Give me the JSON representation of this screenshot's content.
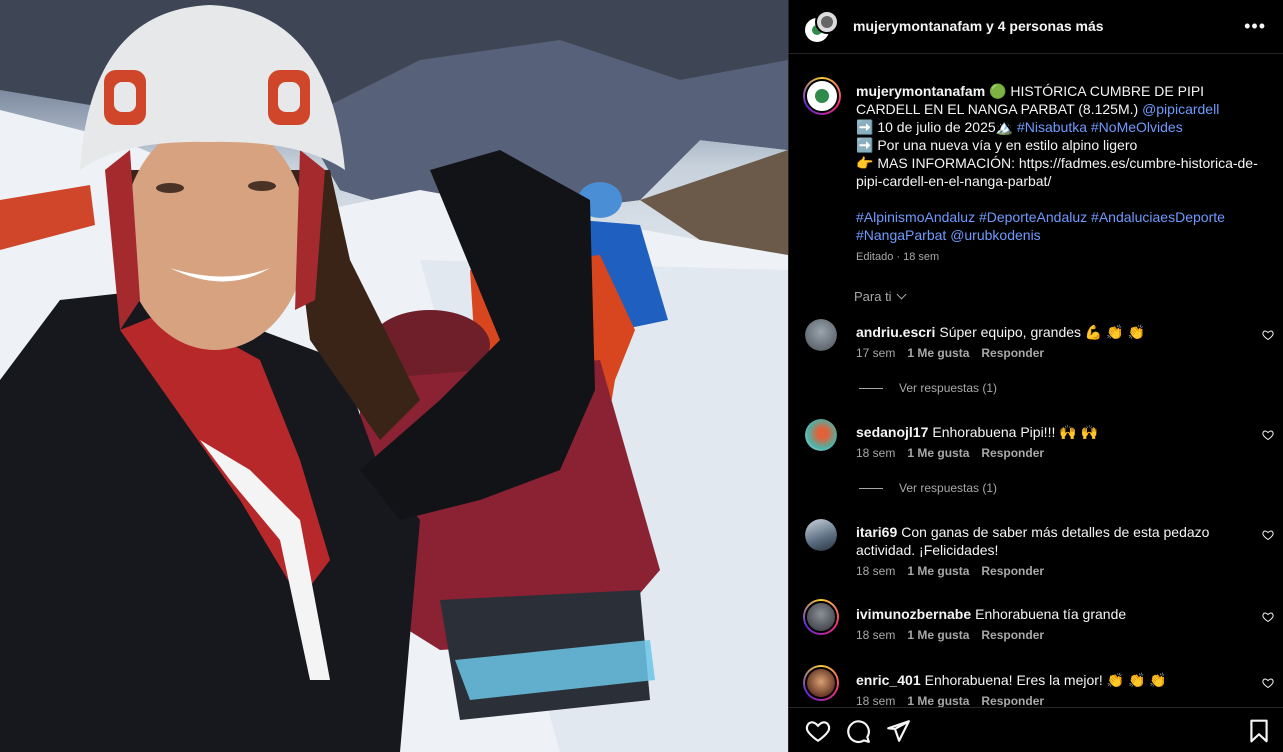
{
  "post_header": {
    "username": "mujerymontanafam",
    "coauthors": " y 4 personas más"
  },
  "icons": {
    "more": "more-options-icon",
    "like": "heart-icon",
    "comment": "comment-icon",
    "share": "share-icon",
    "save": "bookmark-icon"
  },
  "caption": {
    "username": "mujerymontanafam",
    "line1": " 🟢 HISTÓRICA CUMBRE DE PIPI CARDELL EN EL NANGA PARBAT (8.125M.) ",
    "mention1": "@pipicardell",
    "line2": "➡️ 10 de julio de 2025🏔️ ",
    "line2_tags": "#Nisabutka #NoMeOlvides",
    "line3": "➡️ Por una nueva vía y en estilo alpino ligero",
    "line4": "👉 MAS INFORMACIÓN: https://fadmes.es/cumbre-historica-de-pipi-cardell-en-el-nanga-parbat/",
    "tags": "#AlpinismoAndaluz #DeporteAndaluz #AndaluciaesDeporte #NangaParbat ",
    "mention2": "@urubkodenis",
    "meta": "Editado · 18 sem"
  },
  "for_you": "Para ti",
  "comments": [
    {
      "user": "andriu.escri",
      "text": "Súper equipo, grandes 💪 👏 👏",
      "time": "17 sem",
      "likes": "1 Me gusta",
      "reply": "Responder",
      "view_replies": "Ver respuestas (1)"
    },
    {
      "user": "sedanojl17",
      "text": "Enhorabuena Pipi!!! 🙌 🙌",
      "time": "18 sem",
      "likes": "1 Me gusta",
      "reply": "Responder",
      "view_replies": "Ver respuestas (1)"
    },
    {
      "user": "itari69",
      "text": "Con ganas de saber más detalles de esta pedazo actividad. ¡Felicidades!",
      "time": "18 sem",
      "likes": "1 Me gusta",
      "reply": "Responder"
    },
    {
      "user": "ivimunozbernabe",
      "text": "Enhorabuena tía grande",
      "time": "18 sem",
      "likes": "1 Me gusta",
      "reply": "Responder"
    },
    {
      "user": "enric_401",
      "text": "Enhorabuena! Eres la mejor! 👏 👏 👏",
      "time": "18 sem",
      "likes": "1 Me gusta",
      "reply": "Responder"
    }
  ],
  "colors": {
    "link": "#6f9bff",
    "muted": "#a8a8a8",
    "panel_bg": "#000000",
    "divider": "#262626"
  }
}
